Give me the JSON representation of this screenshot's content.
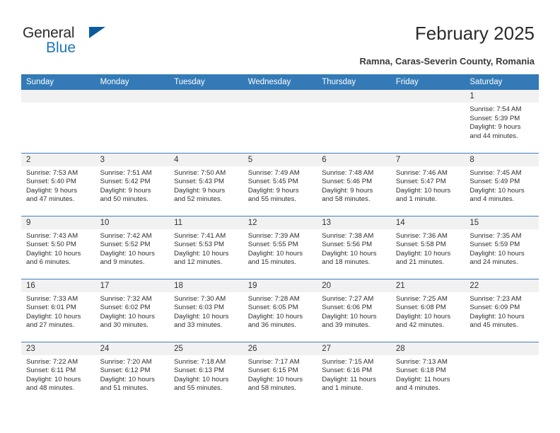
{
  "brand": {
    "name_part1": "General",
    "name_part2": "Blue",
    "triangle_icon": "triangle-logo-icon",
    "accent_color": "#1d76bd",
    "logo_dark": "#2b2b2b"
  },
  "header": {
    "title": "February 2025",
    "subtitle": "Ramna, Caras-Severin County, Romania"
  },
  "theme": {
    "header_bg": "#337ab7",
    "daynum_bg": "#f1f1f1",
    "row_divider": "#3f7fbf",
    "text": "#2e2e2e"
  },
  "columns": [
    "Sunday",
    "Monday",
    "Tuesday",
    "Wednesday",
    "Thursday",
    "Friday",
    "Saturday"
  ],
  "labels": {
    "sunrise": "Sunrise:",
    "sunset": "Sunset:",
    "daylight": "Daylight:"
  },
  "weeks": [
    [
      {
        "day": "",
        "blank": true
      },
      {
        "day": "",
        "blank": true
      },
      {
        "day": "",
        "blank": true
      },
      {
        "day": "",
        "blank": true
      },
      {
        "day": "",
        "blank": true
      },
      {
        "day": "",
        "blank": true
      },
      {
        "day": "1",
        "sunrise": "Sunrise: 7:54 AM",
        "sunset": "Sunset: 5:39 PM",
        "daylight_l1": "Daylight: 9 hours",
        "daylight_l2": "and 44 minutes."
      }
    ],
    [
      {
        "day": "2",
        "sunrise": "Sunrise: 7:53 AM",
        "sunset": "Sunset: 5:40 PM",
        "daylight_l1": "Daylight: 9 hours",
        "daylight_l2": "and 47 minutes."
      },
      {
        "day": "3",
        "sunrise": "Sunrise: 7:51 AM",
        "sunset": "Sunset: 5:42 PM",
        "daylight_l1": "Daylight: 9 hours",
        "daylight_l2": "and 50 minutes."
      },
      {
        "day": "4",
        "sunrise": "Sunrise: 7:50 AM",
        "sunset": "Sunset: 5:43 PM",
        "daylight_l1": "Daylight: 9 hours",
        "daylight_l2": "and 52 minutes."
      },
      {
        "day": "5",
        "sunrise": "Sunrise: 7:49 AM",
        "sunset": "Sunset: 5:45 PM",
        "daylight_l1": "Daylight: 9 hours",
        "daylight_l2": "and 55 minutes."
      },
      {
        "day": "6",
        "sunrise": "Sunrise: 7:48 AM",
        "sunset": "Sunset: 5:46 PM",
        "daylight_l1": "Daylight: 9 hours",
        "daylight_l2": "and 58 minutes."
      },
      {
        "day": "7",
        "sunrise": "Sunrise: 7:46 AM",
        "sunset": "Sunset: 5:47 PM",
        "daylight_l1": "Daylight: 10 hours",
        "daylight_l2": "and 1 minute."
      },
      {
        "day": "8",
        "sunrise": "Sunrise: 7:45 AM",
        "sunset": "Sunset: 5:49 PM",
        "daylight_l1": "Daylight: 10 hours",
        "daylight_l2": "and 4 minutes."
      }
    ],
    [
      {
        "day": "9",
        "sunrise": "Sunrise: 7:43 AM",
        "sunset": "Sunset: 5:50 PM",
        "daylight_l1": "Daylight: 10 hours",
        "daylight_l2": "and 6 minutes."
      },
      {
        "day": "10",
        "sunrise": "Sunrise: 7:42 AM",
        "sunset": "Sunset: 5:52 PM",
        "daylight_l1": "Daylight: 10 hours",
        "daylight_l2": "and 9 minutes."
      },
      {
        "day": "11",
        "sunrise": "Sunrise: 7:41 AM",
        "sunset": "Sunset: 5:53 PM",
        "daylight_l1": "Daylight: 10 hours",
        "daylight_l2": "and 12 minutes."
      },
      {
        "day": "12",
        "sunrise": "Sunrise: 7:39 AM",
        "sunset": "Sunset: 5:55 PM",
        "daylight_l1": "Daylight: 10 hours",
        "daylight_l2": "and 15 minutes."
      },
      {
        "day": "13",
        "sunrise": "Sunrise: 7:38 AM",
        "sunset": "Sunset: 5:56 PM",
        "daylight_l1": "Daylight: 10 hours",
        "daylight_l2": "and 18 minutes."
      },
      {
        "day": "14",
        "sunrise": "Sunrise: 7:36 AM",
        "sunset": "Sunset: 5:58 PM",
        "daylight_l1": "Daylight: 10 hours",
        "daylight_l2": "and 21 minutes."
      },
      {
        "day": "15",
        "sunrise": "Sunrise: 7:35 AM",
        "sunset": "Sunset: 5:59 PM",
        "daylight_l1": "Daylight: 10 hours",
        "daylight_l2": "and 24 minutes."
      }
    ],
    [
      {
        "day": "16",
        "sunrise": "Sunrise: 7:33 AM",
        "sunset": "Sunset: 6:01 PM",
        "daylight_l1": "Daylight: 10 hours",
        "daylight_l2": "and 27 minutes."
      },
      {
        "day": "17",
        "sunrise": "Sunrise: 7:32 AM",
        "sunset": "Sunset: 6:02 PM",
        "daylight_l1": "Daylight: 10 hours",
        "daylight_l2": "and 30 minutes."
      },
      {
        "day": "18",
        "sunrise": "Sunrise: 7:30 AM",
        "sunset": "Sunset: 6:03 PM",
        "daylight_l1": "Daylight: 10 hours",
        "daylight_l2": "and 33 minutes."
      },
      {
        "day": "19",
        "sunrise": "Sunrise: 7:28 AM",
        "sunset": "Sunset: 6:05 PM",
        "daylight_l1": "Daylight: 10 hours",
        "daylight_l2": "and 36 minutes."
      },
      {
        "day": "20",
        "sunrise": "Sunrise: 7:27 AM",
        "sunset": "Sunset: 6:06 PM",
        "daylight_l1": "Daylight: 10 hours",
        "daylight_l2": "and 39 minutes."
      },
      {
        "day": "21",
        "sunrise": "Sunrise: 7:25 AM",
        "sunset": "Sunset: 6:08 PM",
        "daylight_l1": "Daylight: 10 hours",
        "daylight_l2": "and 42 minutes."
      },
      {
        "day": "22",
        "sunrise": "Sunrise: 7:23 AM",
        "sunset": "Sunset: 6:09 PM",
        "daylight_l1": "Daylight: 10 hours",
        "daylight_l2": "and 45 minutes."
      }
    ],
    [
      {
        "day": "23",
        "sunrise": "Sunrise: 7:22 AM",
        "sunset": "Sunset: 6:11 PM",
        "daylight_l1": "Daylight: 10 hours",
        "daylight_l2": "and 48 minutes."
      },
      {
        "day": "24",
        "sunrise": "Sunrise: 7:20 AM",
        "sunset": "Sunset: 6:12 PM",
        "daylight_l1": "Daylight: 10 hours",
        "daylight_l2": "and 51 minutes."
      },
      {
        "day": "25",
        "sunrise": "Sunrise: 7:18 AM",
        "sunset": "Sunset: 6:13 PM",
        "daylight_l1": "Daylight: 10 hours",
        "daylight_l2": "and 55 minutes."
      },
      {
        "day": "26",
        "sunrise": "Sunrise: 7:17 AM",
        "sunset": "Sunset: 6:15 PM",
        "daylight_l1": "Daylight: 10 hours",
        "daylight_l2": "and 58 minutes."
      },
      {
        "day": "27",
        "sunrise": "Sunrise: 7:15 AM",
        "sunset": "Sunset: 6:16 PM",
        "daylight_l1": "Daylight: 11 hours",
        "daylight_l2": "and 1 minute."
      },
      {
        "day": "28",
        "sunrise": "Sunrise: 7:13 AM",
        "sunset": "Sunset: 6:18 PM",
        "daylight_l1": "Daylight: 11 hours",
        "daylight_l2": "and 4 minutes."
      },
      {
        "day": "",
        "blank": true
      }
    ]
  ]
}
